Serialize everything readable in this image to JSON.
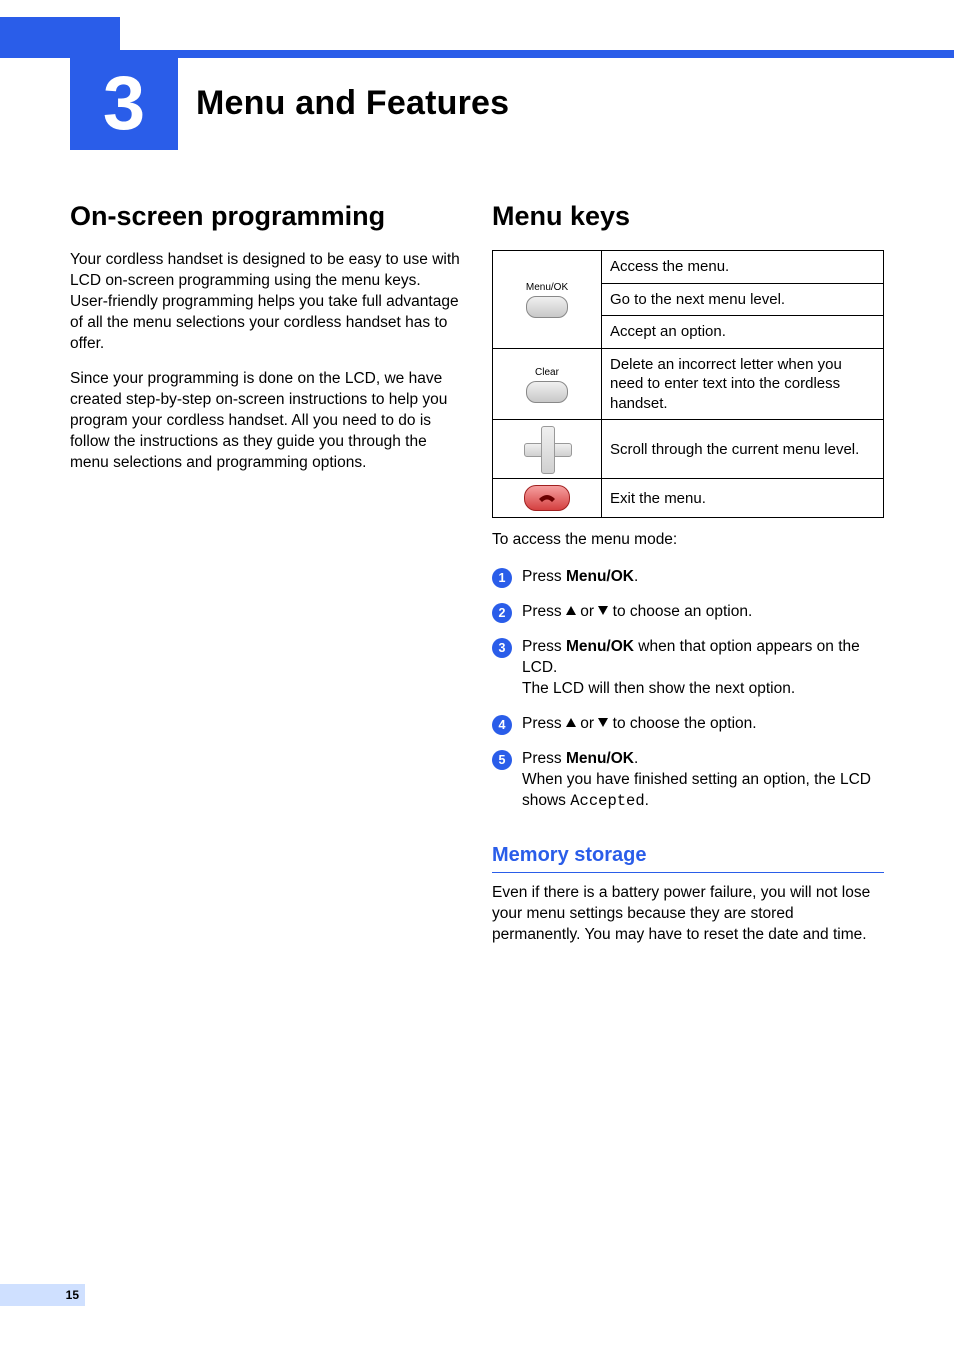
{
  "chapter": {
    "number": "3",
    "title": "Menu and Features"
  },
  "left": {
    "heading": "On-screen programming",
    "p1": "Your cordless handset is designed to be easy to use with LCD on-screen programming using the menu keys. User-friendly programming helps you take full advantage of all the menu selections your cordless handset has to offer.",
    "p2": "Since your programming is done on the LCD, we have created step-by-step on-screen instructions to help you program your cordless handset. All you need to do is follow the instructions as they guide you through the menu selections and programming options."
  },
  "right": {
    "heading": "Menu keys",
    "table": {
      "menuok_label": "Menu/OK",
      "clear_label": "Clear",
      "menuok": {
        "l1": "Access the menu.",
        "l2": "Go to the next menu level.",
        "l3": "Accept an option."
      },
      "clear": "Delete an incorrect letter when you need to enter text into the cordless handset.",
      "dpad": "Scroll through the current menu level.",
      "end": "Exit the menu."
    },
    "intro": "To access the menu mode:",
    "steps": {
      "s1": {
        "pre": "Press ",
        "bold": "Menu/OK",
        "post": "."
      },
      "s2": {
        "pre": "Press ",
        "mid": " or ",
        "post": " to choose an option."
      },
      "s3": {
        "pre": "Press ",
        "bold": "Menu/OK",
        "mid": " when that option appears on the LCD.",
        "line2": "The LCD will then show the next option."
      },
      "s4": {
        "pre": "Press ",
        "mid": " or ",
        "post": " to choose the option."
      },
      "s5": {
        "pre": "Press ",
        "bold": "Menu/OK",
        "post": ".",
        "line2a": "When you have finished setting an option, the LCD shows ",
        "code": "Accepted",
        "line2b": "."
      }
    },
    "memory": {
      "heading": "Memory storage",
      "body": "Even if there is a battery power failure, you will not lose your menu settings because they are stored permanently. You may have to reset the date and time."
    }
  },
  "page_number": "15"
}
